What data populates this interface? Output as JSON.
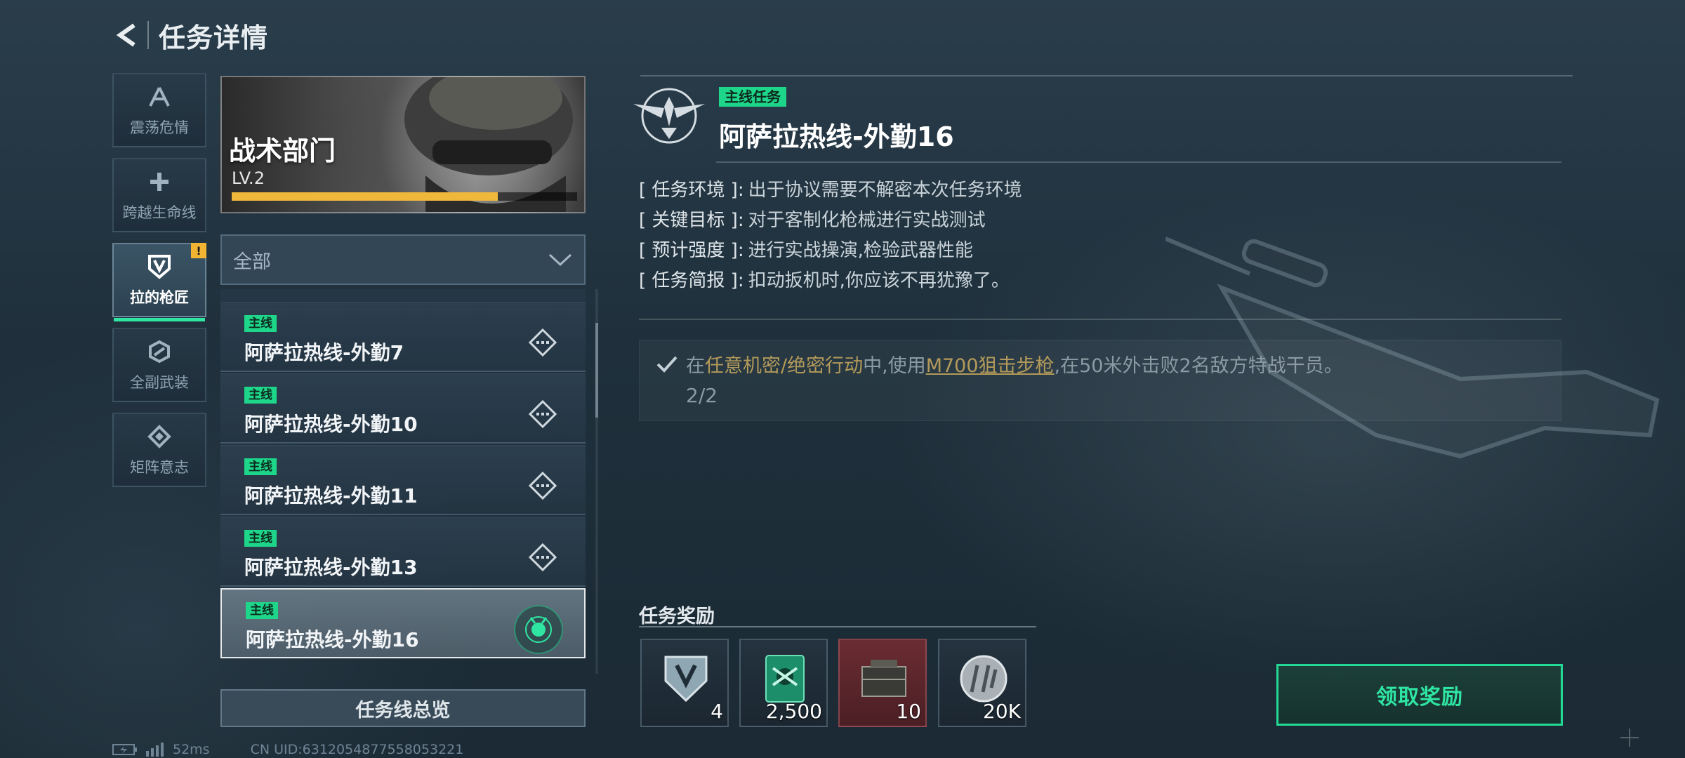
{
  "header": {
    "title": "任务详情"
  },
  "rail": {
    "items": [
      {
        "label": "震荡危情",
        "icon": "tripod-icon"
      },
      {
        "label": "跨越生命线",
        "icon": "medic-cross-icon"
      },
      {
        "label": "拉的枪匠",
        "icon": "shield-v-icon",
        "badge": "!"
      },
      {
        "label": "全副武装",
        "icon": "hex-armor-icon"
      },
      {
        "label": "矩阵意志",
        "icon": "matrix-diamond-icon"
      }
    ]
  },
  "department": {
    "name": "战术部门",
    "level": "LV.2",
    "progress": 0.77
  },
  "filter": {
    "selected": "全部"
  },
  "missions": [
    {
      "tag": "主线",
      "name": "阿萨拉热线-外勤7",
      "state": "pending"
    },
    {
      "tag": "主线",
      "name": "阿萨拉热线-外勤10",
      "state": "pending"
    },
    {
      "tag": "主线",
      "name": "阿萨拉热线-外勤11",
      "state": "pending"
    },
    {
      "tag": "主线",
      "name": "阿萨拉热线-外勤13",
      "state": "pending"
    },
    {
      "tag": "主线",
      "name": "阿萨拉热线-外勤16",
      "state": "selected"
    }
  ],
  "overview_button": "任务线总览",
  "status_bar": {
    "ping": "52ms",
    "uid": "CN UID:6312054877558053221"
  },
  "detail": {
    "tag": "主线任务",
    "title": "阿萨拉热线-外勤16",
    "info": [
      {
        "key": "[ 任务环境 ]:",
        "value": "出于协议需要不解密本次任务环境"
      },
      {
        "key": "[ 关键目标 ]:",
        "value": "对于客制化枪械进行实战测试"
      },
      {
        "key": "[ 预计强度 ]:",
        "value": "进行实战操演,检验武器性能"
      },
      {
        "key": "[ 任务简报 ]:",
        "value": "扣动扳机时,你应该不再犹豫了。"
      }
    ],
    "objective": {
      "part1": "在",
      "mode": "任意机密/绝密行动",
      "part2": "中,使用",
      "weapon": "M700狙击步枪",
      "part3": ",在50米外击败2名敌方特战干员。",
      "progress": "2/2"
    }
  },
  "rewards": {
    "title": "任务奖励",
    "items": [
      {
        "icon": "shield-badge-icon",
        "qty": "4"
      },
      {
        "icon": "drone-card-icon",
        "qty": "2,500"
      },
      {
        "icon": "ammo-crate-icon",
        "qty": "10"
      },
      {
        "icon": "coin-icon",
        "qty": "20K"
      }
    ],
    "claim_button": "领取奖励"
  },
  "colors": {
    "accent_green": "#1ed68a",
    "xp_gold": "#f0b83a",
    "claim_green": "#23d996",
    "highlight_gold": "#b39a5a"
  }
}
